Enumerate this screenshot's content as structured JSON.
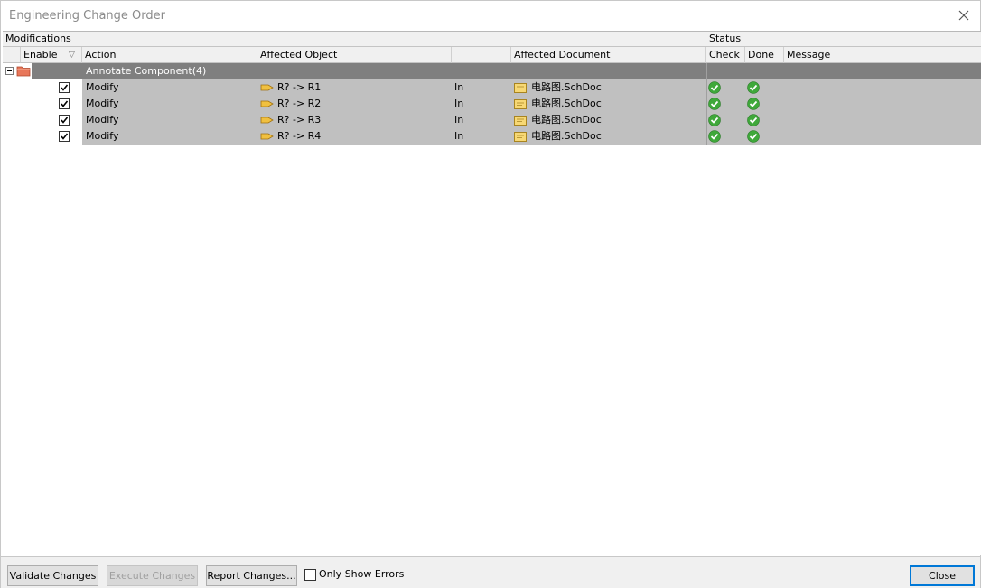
{
  "window": {
    "title": "Engineering Change Order"
  },
  "grid": {
    "group_headers": {
      "modifications": "Modifications",
      "status": "Status"
    },
    "columns": {
      "enable": "Enable",
      "action": "Action",
      "affected_object": "Affected Object",
      "direction": "",
      "affected_document": "Affected Document",
      "check": "Check",
      "done": "Done",
      "message": "Message"
    },
    "group": {
      "label": "Annotate Component(4)"
    },
    "rows": [
      {
        "enabled": true,
        "action": "Modify",
        "object": "R? -> R1",
        "direction": "In",
        "document": "电路图.SchDoc",
        "check": "ok",
        "done": "ok",
        "message": ""
      },
      {
        "enabled": true,
        "action": "Modify",
        "object": "R? -> R2",
        "direction": "In",
        "document": "电路图.SchDoc",
        "check": "ok",
        "done": "ok",
        "message": ""
      },
      {
        "enabled": true,
        "action": "Modify",
        "object": "R? -> R3",
        "direction": "In",
        "document": "电路图.SchDoc",
        "check": "ok",
        "done": "ok",
        "message": ""
      },
      {
        "enabled": true,
        "action": "Modify",
        "object": "R? -> R4",
        "direction": "In",
        "document": "电路图.SchDoc",
        "check": "ok",
        "done": "ok",
        "message": ""
      }
    ]
  },
  "buttons": {
    "validate": "Validate Changes",
    "execute": "Execute Changes",
    "report": "Report Changes...",
    "only_errors": "Only Show Errors",
    "close": "Close"
  },
  "colors": {
    "group_row": "#7f7f7f",
    "data_row": "#c0c0c0",
    "status_ok": "#3fa83a",
    "primary_border": "#0078d7"
  }
}
